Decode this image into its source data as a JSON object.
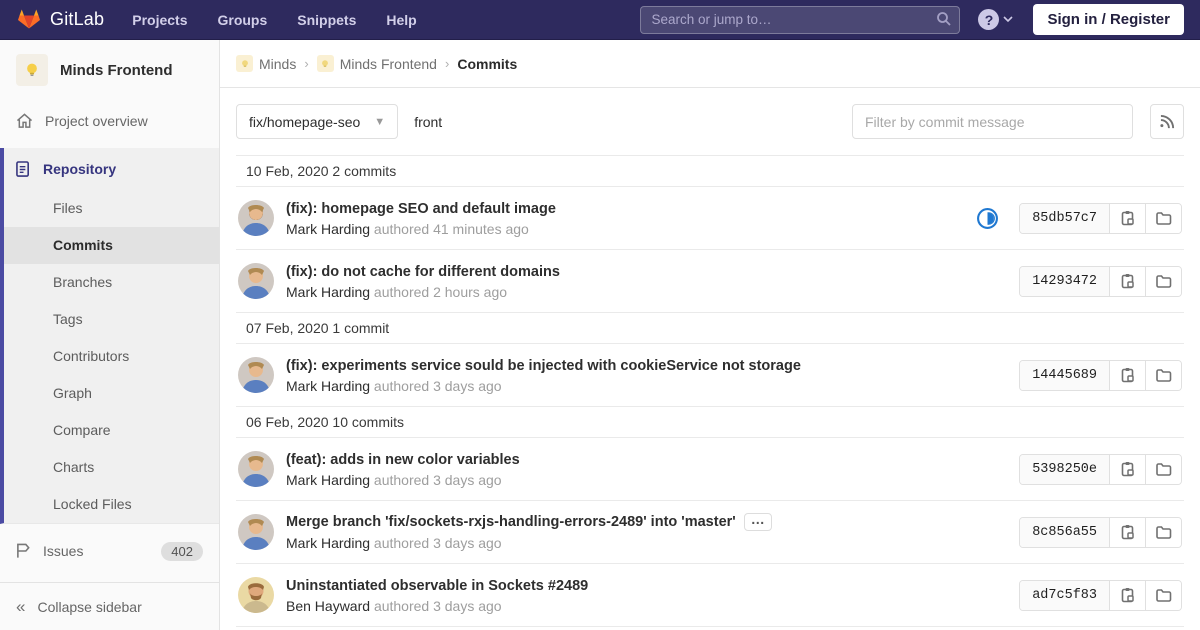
{
  "navbar": {
    "brand": "GitLab",
    "links": [
      "Projects",
      "Groups",
      "Snippets",
      "Help"
    ],
    "search_placeholder": "Search or jump to…",
    "help_glyph": "?",
    "sign_in_label": "Sign in / Register"
  },
  "sidebar": {
    "project_name": "Minds Frontend",
    "overview_label": "Project overview",
    "repository_label": "Repository",
    "repository_items": [
      "Files",
      "Commits",
      "Branches",
      "Tags",
      "Contributors",
      "Graph",
      "Compare",
      "Charts",
      "Locked Files"
    ],
    "active_item": "Commits",
    "issues_label": "Issues",
    "issues_count": "402",
    "collapse_label": "Collapse sidebar"
  },
  "breadcrumb": {
    "group": "Minds",
    "project": "Minds Frontend",
    "current": "Commits",
    "separator": "›"
  },
  "toolbar": {
    "branch": "fix/homepage-seo",
    "path": "front",
    "filter_placeholder": "Filter by commit message"
  },
  "commits": {
    "groups": [
      {
        "date": "10 Feb, 2020",
        "count_label": "2 commits",
        "items": [
          {
            "title": "(fix): homepage SEO and default image",
            "author": "Mark Harding",
            "meta": "authored 41 minutes ago",
            "sha": "85db57c7",
            "pipeline_status": "running"
          },
          {
            "title": "(fix): do not cache for different domains",
            "author": "Mark Harding",
            "meta": "authored 2 hours ago",
            "sha": "14293472"
          }
        ]
      },
      {
        "date": "07 Feb, 2020",
        "count_label": "1 commit",
        "items": [
          {
            "title": "(fix): experiments service sould be injected with cookieService not storage",
            "author": "Mark Harding",
            "meta": "authored 3 days ago",
            "sha": "14445689"
          }
        ]
      },
      {
        "date": "06 Feb, 2020",
        "count_label": "10 commits",
        "items": [
          {
            "title": "(feat): adds in new color variables",
            "author": "Mark Harding",
            "meta": "authored 3 days ago",
            "sha": "5398250e"
          },
          {
            "title": "Merge branch 'fix/sockets-rxjs-handling-errors-2489' into 'master'",
            "has_description_toggle": true,
            "toggle_glyph": "…",
            "author": "Mark Harding",
            "meta": "authored 3 days ago",
            "sha": "8c856a55"
          },
          {
            "title": "Uninstantiated observable in Sockets #2489",
            "author": "Ben Hayward",
            "meta": "authored 3 days ago",
            "sha": "ad7c5f83"
          }
        ]
      }
    ]
  },
  "colors": {
    "navbar_bg": "#2e2a5e",
    "sidebar_active_border": "#4b4ba3",
    "repository_text": "#36357f",
    "pipeline_running_blue": "#1f78d1",
    "logo_red": "#e24329",
    "logo_orange": "#fc6d26",
    "logo_yellow": "#fca326"
  }
}
